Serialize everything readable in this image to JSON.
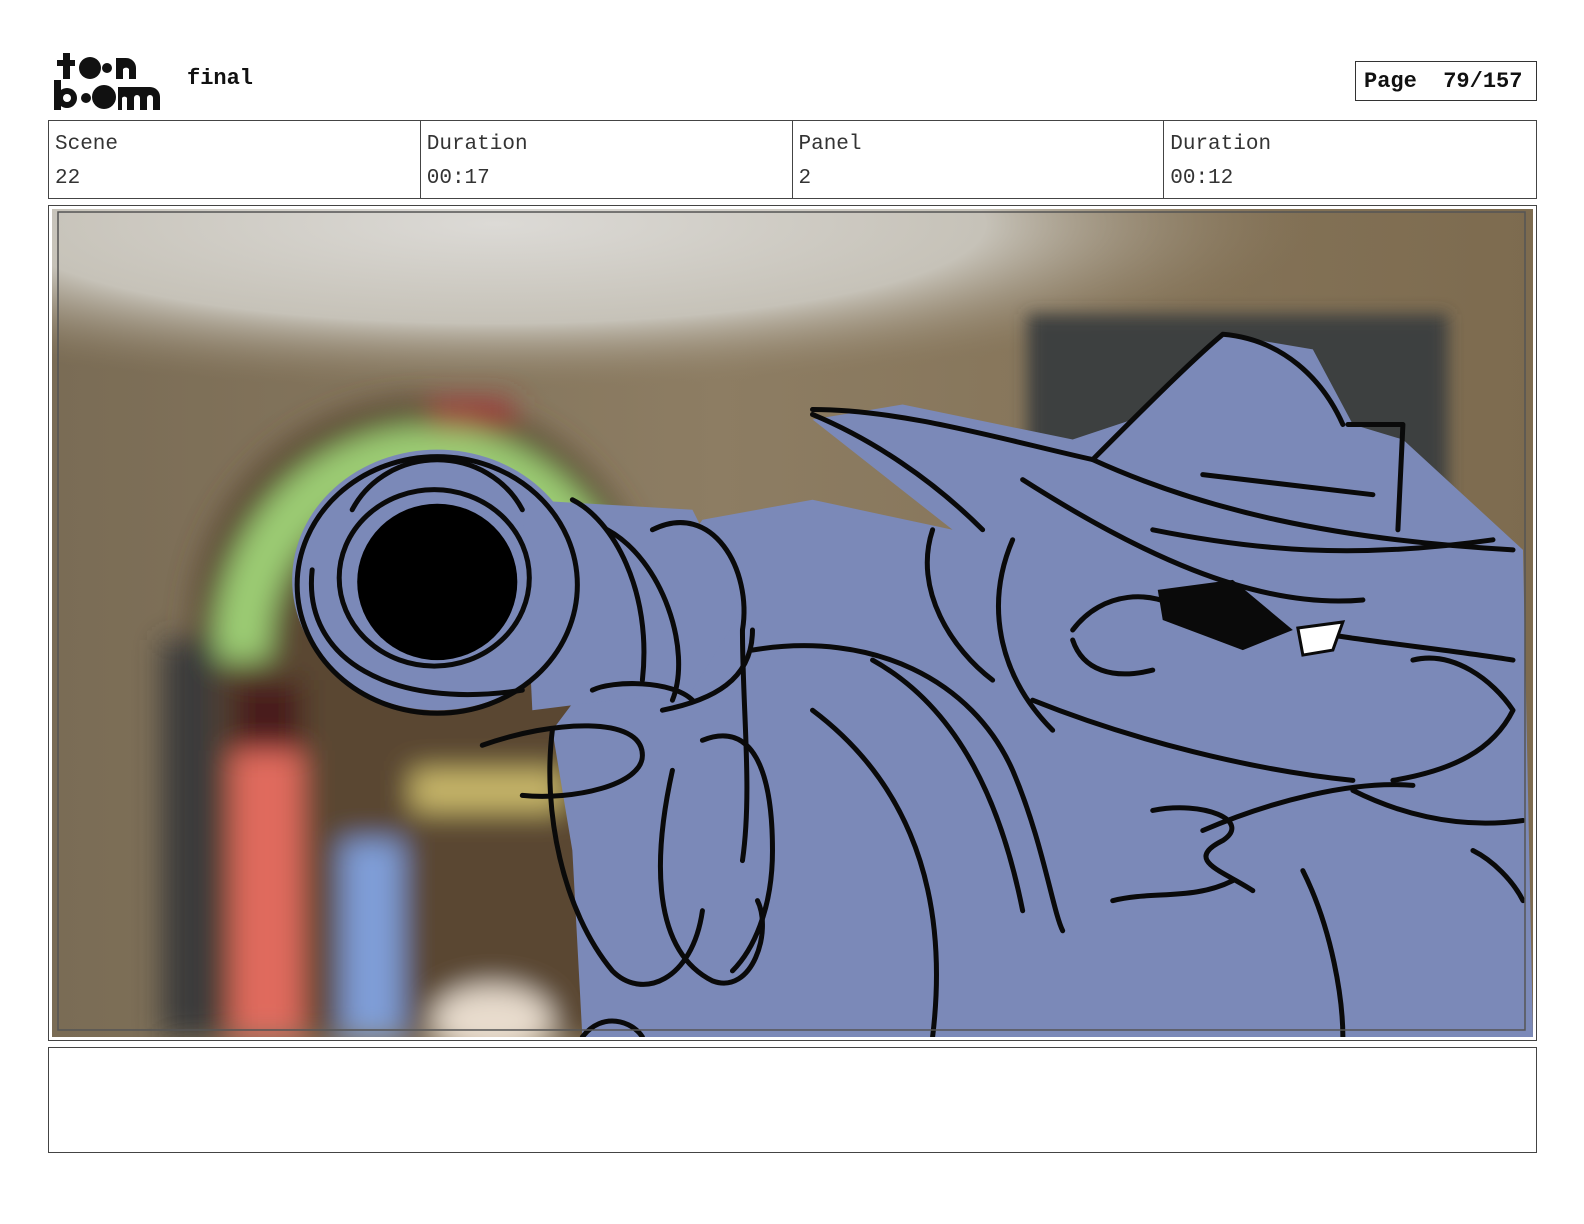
{
  "header": {
    "logo_text": "toon boom",
    "project_name": "final",
    "page_label": "Page",
    "page_value": "79/157"
  },
  "info": {
    "scene_label": "Scene",
    "scene_value": "22",
    "scene_duration_label": "Duration",
    "scene_duration_value": "00:17",
    "panel_label": "Panel",
    "panel_value": "2",
    "panel_duration_label": "Duration",
    "panel_duration_value": "00:12"
  },
  "panel": {
    "image": "storyboard-sketch-gun-barrel-closeup",
    "colors": {
      "character_fill": "#7b89b8",
      "line": "#0a0a0a",
      "wall": "#8a7a60",
      "ceiling": "#d6d4d0",
      "jukebox_arch": "#8fbf6a"
    }
  },
  "dialogue": {
    "text": ""
  }
}
